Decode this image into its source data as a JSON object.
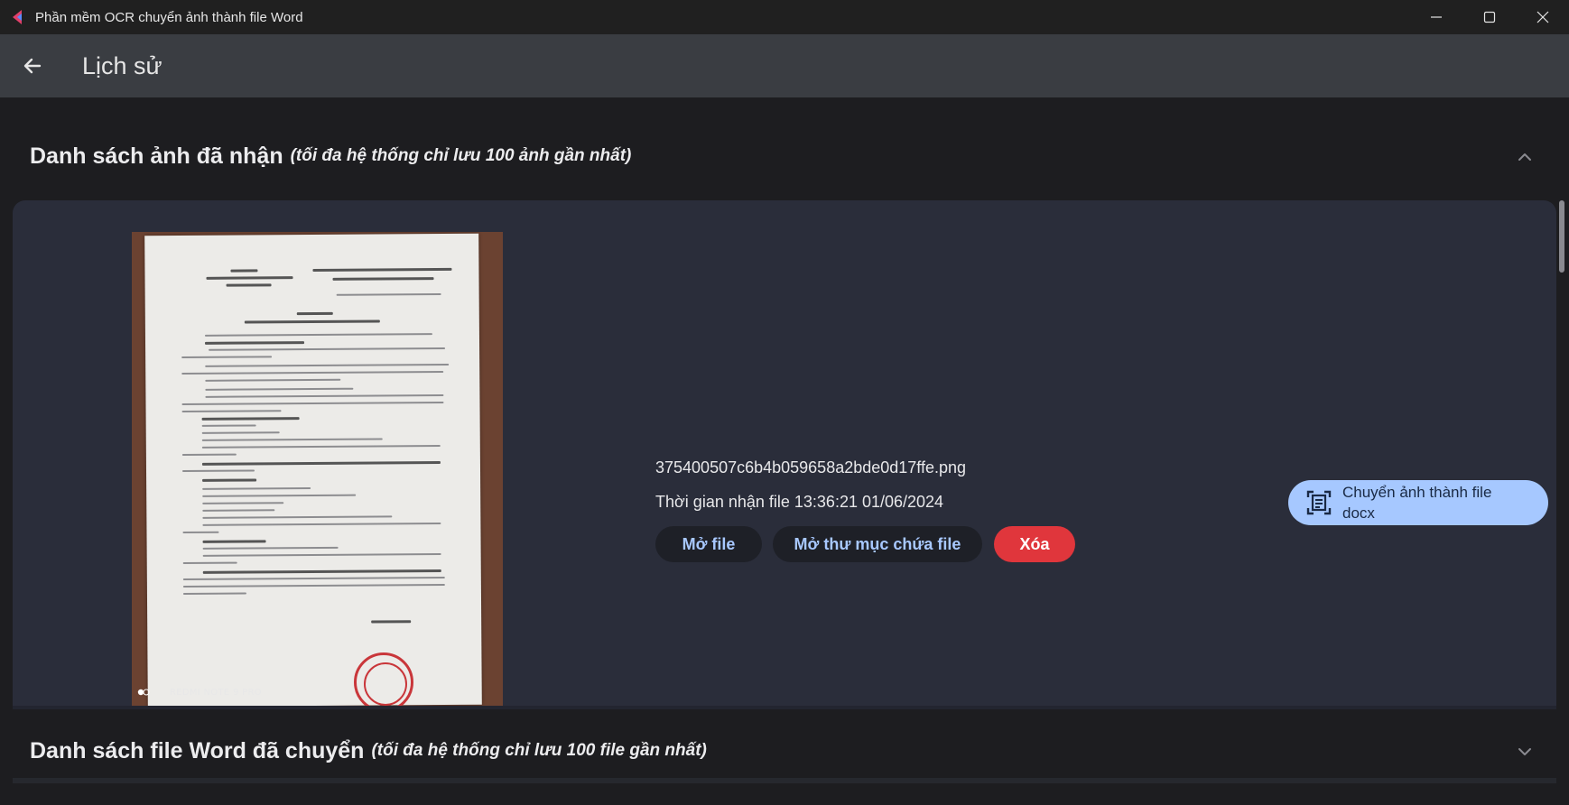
{
  "window": {
    "title": "Phần mềm OCR chuyển ảnh thành file Word"
  },
  "appbar": {
    "title": "Lịch sử"
  },
  "received_section": {
    "title": "Danh sách ảnh đã nhận",
    "note": "(tối đa hệ thống chỉ lưu 100 ảnh gần nhất)",
    "expanded": true
  },
  "image_item": {
    "camera_watermark": "REDMI NOTE 9 PRO",
    "file_name": "375400507c6b4b059658a2bde0d17ffe.png",
    "received_time": "Thời gian nhận file 13:36:21 01/06/2024",
    "buttons": {
      "open_file": "Mở file",
      "open_folder": "Mở thư mục chứa file",
      "delete": "Xóa",
      "convert": "Chuyển ảnh thành file docx"
    }
  },
  "word_section": {
    "title": "Danh sách file Word đã chuyển",
    "note": "(tối đa hệ thống chỉ lưu 100 file gần nhất)",
    "expanded": false
  },
  "colors": {
    "appbar_bg": "#3a3d42",
    "card_bg": "#2a2d3a",
    "accent": "#a6c8ff",
    "danger": "#e0363c"
  }
}
